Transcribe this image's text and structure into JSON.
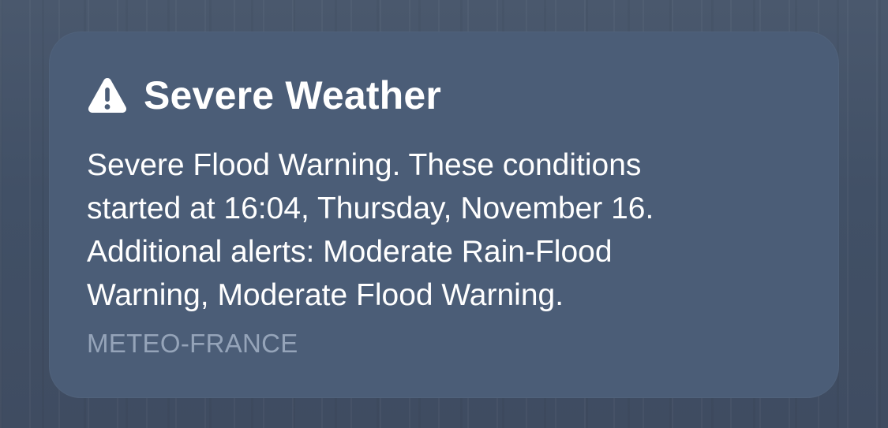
{
  "notification": {
    "icon": "warning-triangle-icon",
    "title": "Severe Weather",
    "body_lines": [
      "Severe Flood Warning. These conditions",
      "started at 16:04, Thursday, November 16.",
      "Additional alerts: Moderate Rain-Flood",
      "Warning, Moderate Flood Warning."
    ],
    "source": "METEO-FRANCE"
  },
  "colors": {
    "background": "#3f4d63",
    "card": "#4b5d77",
    "title_text": "#ffffff",
    "source_text": "#95a4b9"
  }
}
